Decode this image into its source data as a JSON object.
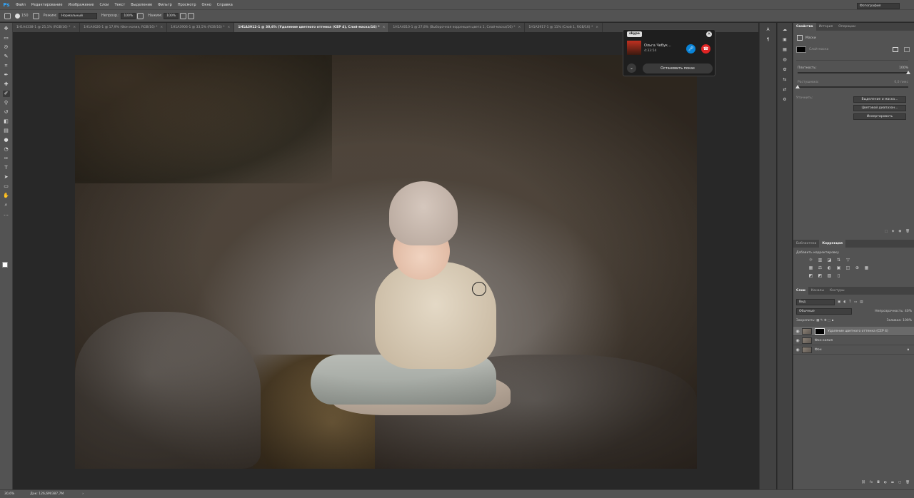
{
  "app": {
    "logo": "Ps"
  },
  "menu": [
    "Файл",
    "Редактирование",
    "Изображение",
    "Слои",
    "Текст",
    "Выделение",
    "Фильтр",
    "Просмотр",
    "Окно",
    "Справка"
  ],
  "options": {
    "brush_size": "150",
    "mode_label": "Режим:",
    "mode_value": "Нормальный",
    "opacity_label": "Непрозр.:",
    "opacity_value": "100%",
    "flow_label": "Нажим:",
    "flow_value": "100%",
    "workspace": "Фотография"
  },
  "tabs": [
    {
      "label": "1H1A4338-1 @ 25,1% (RGB/16) *"
    },
    {
      "label": "1H1A4026-1 @ 17,9% (Фон копия, RGB/16) *"
    },
    {
      "label": "1H1A3906-1 @ 33,5% (RGB/16) *"
    },
    {
      "label": "1H1A3912-1 @ 30,6% (Удаление цветного оттенка (CEP 4), Слой-маска/16) *",
      "active": true
    },
    {
      "label": "1H1A4010-1 @ 27,8% (Выборочная коррекция цвета 1, Слой-маска/16) *"
    },
    {
      "label": "1H1A3917-1 @ 11% (Слой 1, RGB/16) *"
    }
  ],
  "status": {
    "zoom": "30,6%",
    "doc": "Док: 126,6M/387,7M"
  },
  "skype": {
    "logo": "skype",
    "caller": "Ольга Чебук...",
    "duration": "4:33:54",
    "stop_label": "Остановить показ"
  },
  "properties": {
    "tabs": [
      "Свойства",
      "История",
      "Операции"
    ],
    "title": "Маски",
    "layer_mask_label": "Слой-маска",
    "density_label": "Плотность:",
    "density_value": "100%",
    "feather_label": "Растушевка:",
    "feather_value": "0,0 пикс",
    "refine_label": "Уточнить:",
    "btn_select_mask": "Выделение и маска...",
    "btn_color_range": "Цветовой диапазон...",
    "btn_invert": "Инвертировать"
  },
  "adjustments": {
    "tabs": [
      "Библиотеки",
      "Коррекция"
    ],
    "add_label": "Добавить корректировку",
    "icons": [
      "☼",
      "▥",
      "◪",
      "⇅",
      "▽",
      "",
      "",
      "▦",
      "⚖",
      "◐",
      "▣",
      "◫",
      "⊕",
      "▦",
      "◩",
      "◩",
      "▨",
      "▯"
    ]
  },
  "layers": {
    "tabs": [
      "Слои",
      "Каналы",
      "Контуры"
    ],
    "search_placeholder": "Вид",
    "blend_mode": "Обычные",
    "opacity_label": "Непрозрачность:",
    "opacity_value": "40%",
    "lock_label": "Закрепить:",
    "fill_label": "Заливка:",
    "fill_value": "100%",
    "items": [
      {
        "name": "Удаление цветного оттенка (CEP 4)"
      },
      {
        "name": "Фон копия"
      },
      {
        "name": "Фон"
      }
    ]
  }
}
